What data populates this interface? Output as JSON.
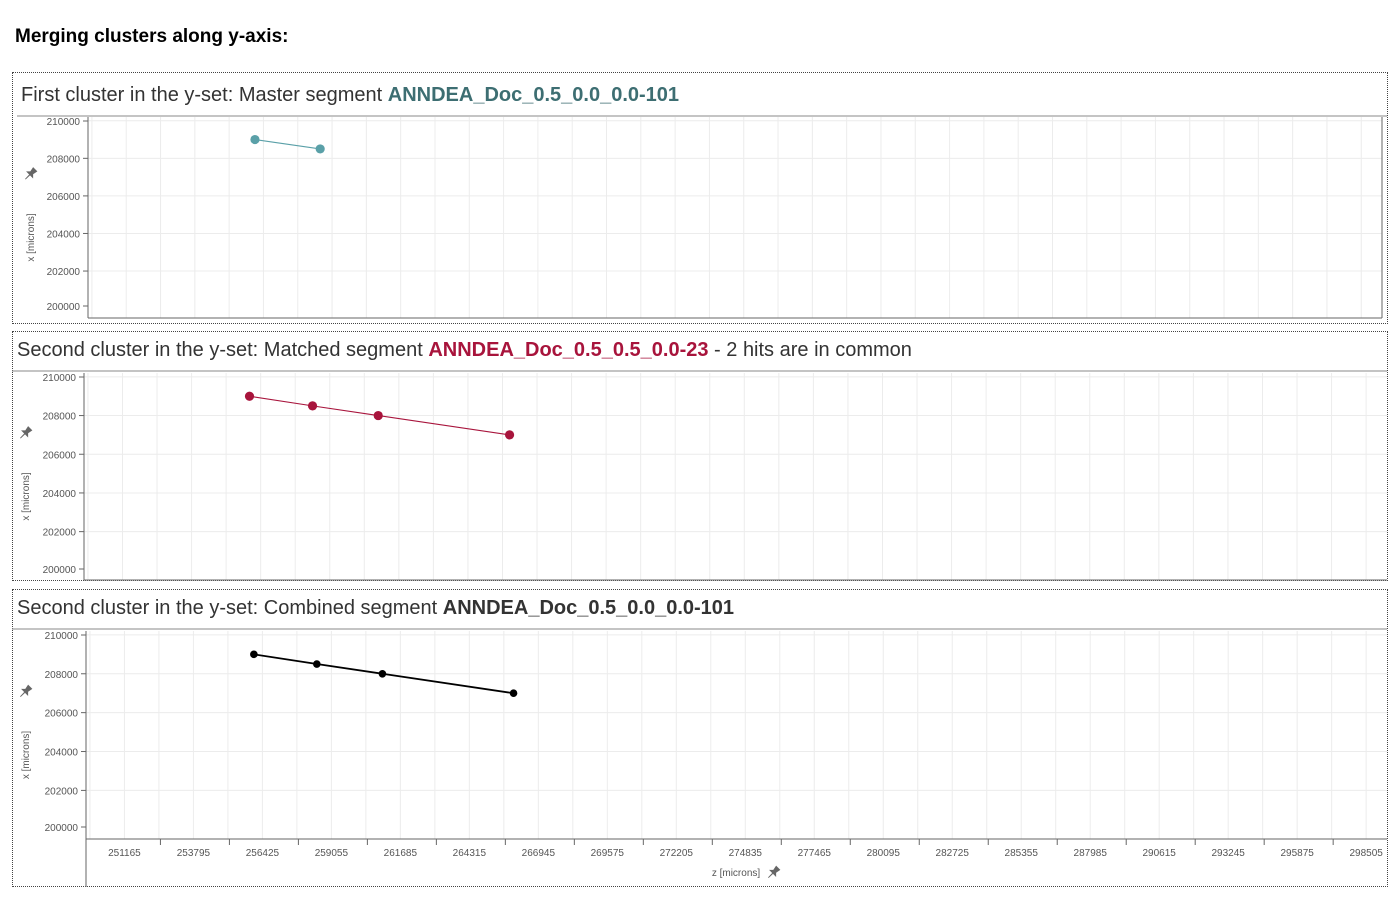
{
  "heading": "Merging clusters along y-axis:",
  "panels": [
    {
      "prefix": "First cluster in the y-set: Master segment ",
      "segment": "ANNDEA_Doc_0.5_0.0_0.0-101",
      "suffix": "",
      "color": "#5aa0a8",
      "title_color": "#3d6e72"
    },
    {
      "prefix": "Second cluster in the y-set: Matched segment ",
      "segment": "ANNDEA_Doc_0.5_0.5_0.0-23",
      "suffix": " - 2 hits are in common",
      "color": "#a8143c",
      "title_color": "#a8143c"
    },
    {
      "prefix": "Second cluster in the y-set: Combined segment ",
      "segment": "ANNDEA_Doc_0.5_0.0_0.0-101",
      "suffix": "",
      "color": "#000000",
      "title_color": "#333333"
    }
  ],
  "chart_data": [
    {
      "type": "line",
      "xlabel": "z [microns]",
      "ylabel": "x [microns]",
      "xlim": [
        249700,
        299300
      ],
      "ylim": [
        199500,
        210200
      ],
      "y_ticks": [
        200000,
        202000,
        204000,
        206000,
        208000,
        210000
      ],
      "x_ticks": [],
      "grid": true,
      "series": [
        {
          "x": [
            256100,
            258600
          ],
          "y": [
            209000,
            208500
          ]
        }
      ]
    },
    {
      "type": "line",
      "xlabel": "z [microns]",
      "ylabel": "x [microns]",
      "xlim": [
        249700,
        299300
      ],
      "ylim": [
        199500,
        210200
      ],
      "y_ticks": [
        200000,
        202000,
        204000,
        206000,
        208000,
        210000
      ],
      "x_ticks": [],
      "grid": true,
      "series": [
        {
          "x": [
            256000,
            258400,
            260900,
            265900
          ],
          "y": [
            209000,
            208500,
            208000,
            207000
          ]
        }
      ]
    },
    {
      "type": "line",
      "xlabel": "z [microns]",
      "ylabel": "x [microns]",
      "xlim": [
        249700,
        299300
      ],
      "ylim": [
        199500,
        210200
      ],
      "y_ticks": [
        200000,
        202000,
        204000,
        206000,
        208000,
        210000
      ],
      "x_ticks": [
        "251165",
        "253795",
        "256425",
        "259055",
        "261685",
        "264315",
        "266945",
        "269575",
        "272205",
        "274835",
        "277465",
        "280095",
        "282725",
        "285355",
        "287985",
        "290615",
        "293245",
        "295875",
        "298505"
      ],
      "grid": true,
      "series": [
        {
          "x": [
            256100,
            258500,
            261000,
            266000
          ],
          "y": [
            209000,
            208500,
            208000,
            207000
          ]
        }
      ]
    }
  ]
}
